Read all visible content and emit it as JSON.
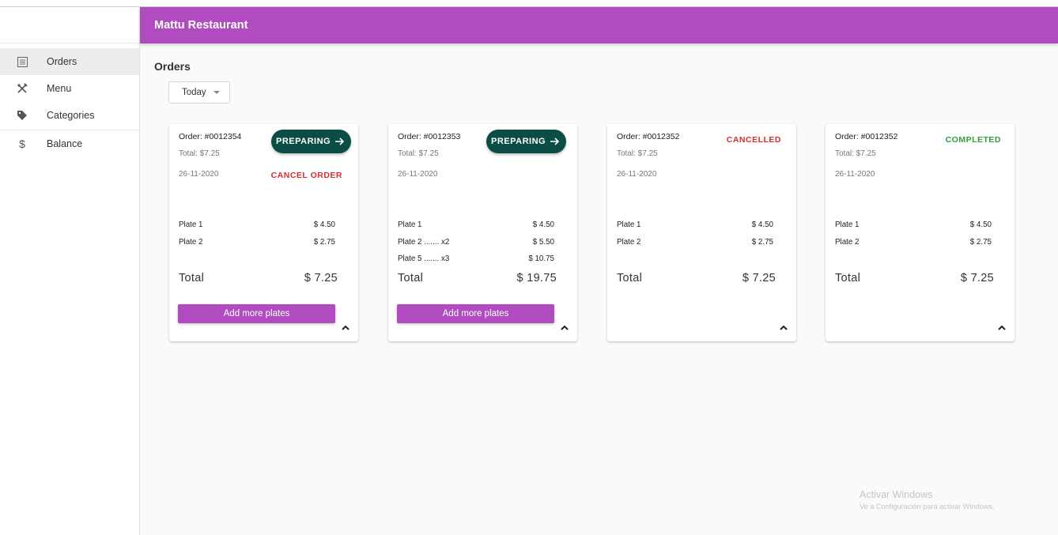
{
  "app": {
    "title": "Mattu Restaurant"
  },
  "sidebar": {
    "items": [
      {
        "label": "Orders",
        "icon": "list-icon",
        "active": true
      },
      {
        "label": "Menu",
        "icon": "utensils-icon"
      },
      {
        "label": "Categories",
        "icon": "tag-icon"
      },
      {
        "label": "Balance",
        "icon": "dollar-icon"
      }
    ]
  },
  "page": {
    "title": "Orders"
  },
  "filter": {
    "selected": "Today"
  },
  "colors": {
    "accent": "#b04bc0",
    "preparing": "#0b4d44",
    "cancelled": "#d32f2f",
    "completed": "#2e9e3a"
  },
  "orders": [
    {
      "order_no": "Order: #0012354",
      "total_small": "Total: $7.25",
      "date": "26-11-2020",
      "status": "PREPARING",
      "cancel_label": "CANCEL ORDER",
      "items": [
        {
          "name": "Plate 1",
          "price": "$ 4.50"
        },
        {
          "name": "Plate 2",
          "price": "$ 2.75"
        }
      ],
      "total_label": "Total",
      "total_value": "$ 7.25",
      "add_label": "Add more plates"
    },
    {
      "order_no": "Order: #0012353",
      "total_small": "Total: $7.25",
      "date": "26-11-2020",
      "status": "PREPARING",
      "items": [
        {
          "name": "Plate 1",
          "price": "$ 4.50"
        },
        {
          "name": "Plate 2 ....... x2",
          "price": "$ 5.50"
        },
        {
          "name": "Plate 5 ....... x3",
          "price": "$ 10.75"
        }
      ],
      "total_label": "Total",
      "total_value": "$ 19.75",
      "add_label": "Add more plates"
    },
    {
      "order_no": "Order: #0012352",
      "total_small": "Total: $7.25",
      "date": "26-11-2020",
      "status": "CANCELLED",
      "items": [
        {
          "name": "Plate 1",
          "price": "$ 4.50"
        },
        {
          "name": "Plate 2",
          "price": "$ 2.75"
        }
      ],
      "total_label": "Total",
      "total_value": "$ 7.25"
    },
    {
      "order_no": "Order: #0012352",
      "total_small": "Total: $7.25",
      "date": "26-11-2020",
      "status": "COMPLETED",
      "items": [
        {
          "name": "Plate 1",
          "price": "$ 4.50"
        },
        {
          "name": "Plate 2",
          "price": "$ 2.75"
        }
      ],
      "total_label": "Total",
      "total_value": "$ 7.25"
    }
  ],
  "watermark": {
    "line1": "Activar Windows",
    "line2": "Ve a Configuración para activar Windows."
  }
}
